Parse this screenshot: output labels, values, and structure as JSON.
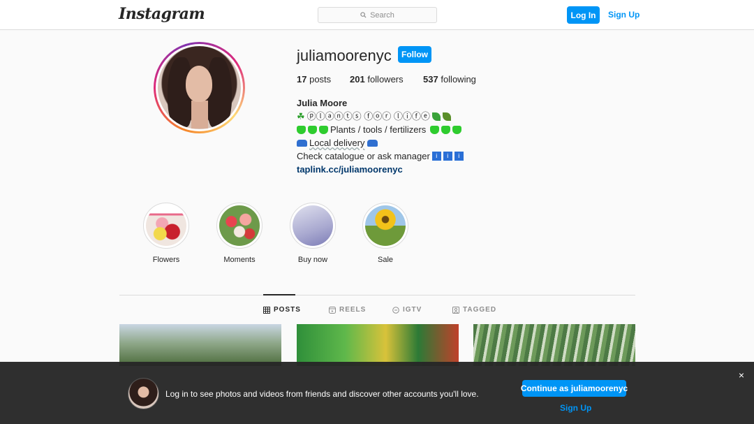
{
  "nav": {
    "logo": "Instagram",
    "search_placeholder": "Search",
    "login_label": "Log In",
    "signup_label": "Sign Up"
  },
  "profile": {
    "username": "juliamoorenyc",
    "follow_label": "Follow",
    "stats": {
      "posts_count": "17",
      "posts_label": "posts",
      "followers_count": "201",
      "followers_label": "followers",
      "following_count": "537",
      "following_label": "following"
    },
    "bio": {
      "full_name": "Julia Moore",
      "line1": "ⓟⓛⓐⓝⓣⓢ ⓕⓞⓡ ⓛⓘⓕⓔ",
      "line2": "Plants / tools / fertilizers",
      "line3": "Local delivery",
      "line4": "Check catalogue or ask manager",
      "link": "taplink.cc/juliamoorenyc"
    }
  },
  "highlights": [
    {
      "label": "Flowers"
    },
    {
      "label": "Moments"
    },
    {
      "label": "Buy now"
    },
    {
      "label": "Sale"
    }
  ],
  "tabs": [
    {
      "label": "POSTS",
      "active": true
    },
    {
      "label": "REELS",
      "active": false
    },
    {
      "label": "IGTV",
      "active": false
    },
    {
      "label": "TAGGED",
      "active": false
    }
  ],
  "login_prompt": {
    "message": "Log in to see photos and videos from friends and discover other accounts you'll love.",
    "continue_label": "Continue as juliamoorenyc",
    "signup_label": "Sign Up",
    "close_symbol": "×"
  },
  "colors": {
    "accent": "#0095f6",
    "text": "#262626",
    "muted": "#8e8e8e",
    "border": "#dbdbdb"
  }
}
